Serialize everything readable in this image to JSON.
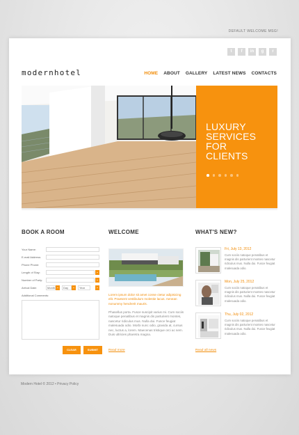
{
  "topbar": {
    "welcome": "DEFAULT WELCOME MSG!"
  },
  "social": [
    "t",
    "f",
    "in",
    "g",
    "r"
  ],
  "logo": "modernhotel",
  "nav": [
    "HOME",
    "ABOUT",
    "GALLERY",
    "LATEST NEWS",
    "CONTACTS"
  ],
  "nav_active": "HOME",
  "hero": {
    "headline": [
      "LUXURY",
      "SERVICES",
      "FOR",
      "CLIENTS"
    ],
    "slides": 6,
    "active_slide": 1,
    "accent": "#f7920e"
  },
  "book": {
    "title": "BOOK A ROOM",
    "fields": [
      "Your Name:",
      "E-mail Address:",
      "Phone Phone:",
      "Length of Stay:",
      "Number of Party:"
    ],
    "arrival_label": "Arrival Date:",
    "month": "Month",
    "day": "Day",
    "year": "Year",
    "comments_label": "Additional Comments:",
    "clear": "CLEAR",
    "submit": "SUBMIT"
  },
  "welcome": {
    "title": "WELCOME",
    "lead": "Lorem ipsum dolor sit amet conse ctetur adipisicing elit. Praesent vestibulum molestie lacus. Aenean nonummy hendrerit mauris.",
    "body": "Phasellus porta. Fusce suscipit varius mi. Cum sociis natoque penatibus et magnis dis parturient montes, nascetur ridiculus mus. Nulla dui. Fusce feugiat malesuada odio. Morbi nunc odio, gravida at, cursus nec, luctus a, lorem. Maecenas tristique orci ac sem. Duis ultricies pharetra magna.",
    "read_more": "Read more"
  },
  "news": {
    "title": "WHAT'S NEW?",
    "items": [
      {
        "date": "Fri, July 13, 2012",
        "text": "Cum sociis natoque penatibus et magnis dis parturient montes nascetur ridiculus mus. Nulla dui. Fusce feugiat malesuada odio."
      },
      {
        "date": "Mon, July 25, 2012",
        "text": "Cum sociis natoque penatibus et magnis dis parturient montes nascetur ridiculus mus. Nulla dui. Fusce feugiat malesuada odio."
      },
      {
        "date": "Thu, July 02, 2012",
        "text": "Cum sociis natoque penatibus et magnis dis parturient montes nascetur ridiculus mus. Nulla dui. Fusce feugiat malesuada odio."
      }
    ],
    "read_more": "Read all news"
  },
  "footer": "Modern Hotel © 2012 • Privacy Policy"
}
